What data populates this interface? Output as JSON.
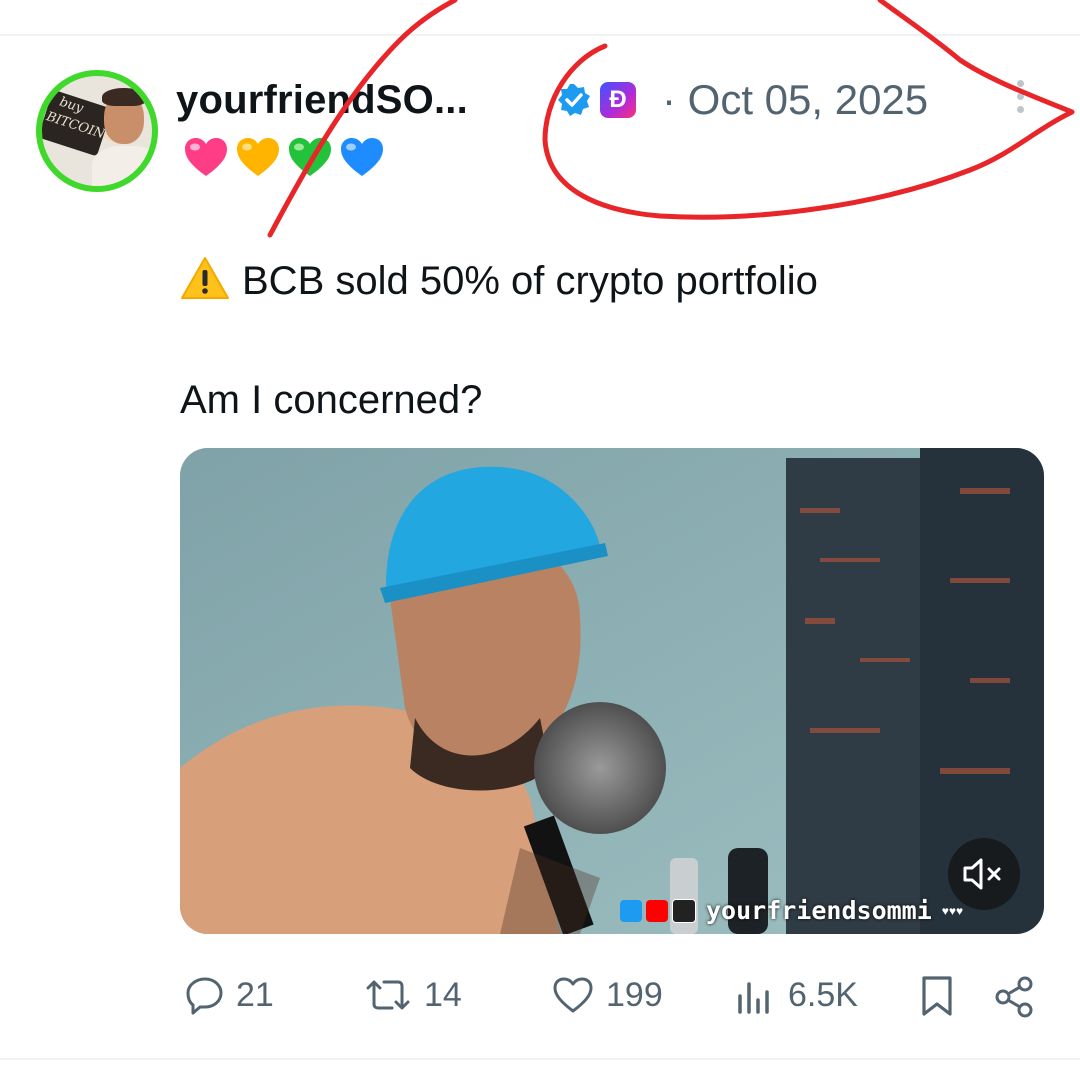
{
  "post": {
    "author_display_name": "yourfriendSO...",
    "emoji_hearts": [
      "pink-heart",
      "yellow-heart",
      "green-heart",
      "blue-heart"
    ],
    "verified_badge": "verified-checkmark-icon",
    "affiliate_badge": "dai-logo-icon",
    "date": "· Oct 05, 2025",
    "text_line_1": "BCB sold 50% of crypto portfolio",
    "text_line_2": "Am I concerned?",
    "avatar_board_text": [
      "buy",
      "BITCOIN"
    ]
  },
  "media": {
    "watermark_handle": "yourfriendsommi",
    "watermark_tail": "♥♥♥",
    "mute_icon": "speaker-muted-icon"
  },
  "actions": {
    "replies": "21",
    "reposts": "14",
    "likes": "199",
    "views": "6.5K"
  },
  "colors": {
    "text_primary": "#0f1419",
    "text_secondary": "#536471",
    "verified_blue": "#1d9bf0",
    "annotation_red": "#e8262a",
    "avatar_ring": "#3fd82b"
  }
}
